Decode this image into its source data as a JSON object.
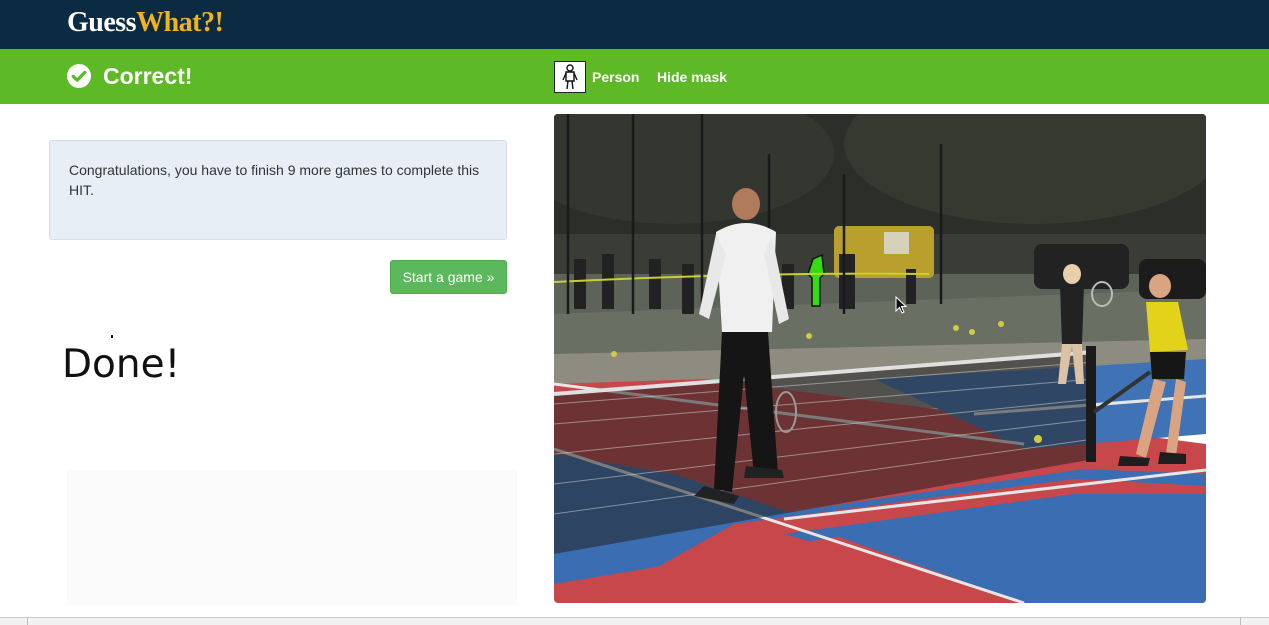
{
  "brand": {
    "part1": "Guess",
    "part2": "What?!"
  },
  "status": {
    "text": "Correct!"
  },
  "object": {
    "label": "Person"
  },
  "actions": {
    "hide_mask": "Hide mask"
  },
  "info": {
    "message": "Congratulations, you have to finish 9 more games to complete this HIT."
  },
  "buttons": {
    "start_game": "Start a game »"
  },
  "done": {
    "text": "Done!"
  },
  "colors": {
    "header_bg": "#0b2b42",
    "status_bg": "#5db925",
    "brand_accent": "#f3b21b",
    "button_bg": "#5cb85c",
    "mask_highlight": "#33dd11"
  },
  "icons": {
    "status": "check-circle-icon",
    "object": "person-icon",
    "cursor": "mouse-pointer-icon"
  }
}
